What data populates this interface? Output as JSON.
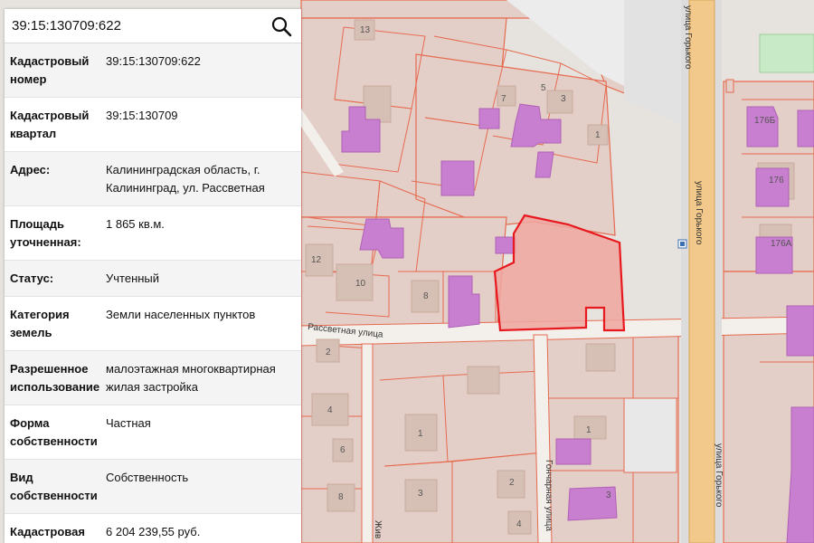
{
  "search": {
    "value": "39:15:130709:622",
    "icon": "magnifier-icon"
  },
  "info_rows": [
    {
      "label": "Кадастровый номер",
      "value": "39:15:130709:622"
    },
    {
      "label": "Кадастровый квартал",
      "value": "39:15:130709"
    },
    {
      "label": "Адрес:",
      "value": "Калининградская область, г. Калининград, ул. Рассветная"
    },
    {
      "label": "Площадь уточненная:",
      "value": "1 865 кв.м."
    },
    {
      "label": "Статус:",
      "value": "Учтенный"
    },
    {
      "label": "Категория земель",
      "value": "Земли населенных пунктов"
    },
    {
      "label": "Разрешенное использование",
      "value": "малоэтажная многоквартирная жилая застройка"
    },
    {
      "label": "Форма собственности",
      "value": "Частная"
    },
    {
      "label": "Вид собственности",
      "value": "Собственность"
    },
    {
      "label": "Кадастровая стоимость",
      "value": "6 204 239,55 руб."
    }
  ],
  "map": {
    "streets": {
      "gorky_top": "улица Горького",
      "gorky_mid": "улица Горького",
      "gorky_bottom": "улица Горького",
      "rassvetnaya": "Рассветная улица",
      "goncharnaya": "Гончарная улица",
      "zhiv": "Жив"
    },
    "parcel_numbers": [
      "13",
      "7",
      "5",
      "3",
      "1",
      "12",
      "10",
      "8",
      "2",
      "4",
      "6",
      "8",
      "1",
      "3",
      "2",
      "4",
      "1",
      "3",
      "176Б",
      "176",
      "176А"
    ],
    "colors": {
      "selected_fill": "#f0a6a0",
      "selected_stroke": "#e8191e",
      "parcel_fill": "#e3cdc6",
      "parcel_stroke": "#e66a50",
      "building": "#c977c9",
      "road": "#f3f0ec",
      "main_road": "#f2c98a"
    }
  }
}
